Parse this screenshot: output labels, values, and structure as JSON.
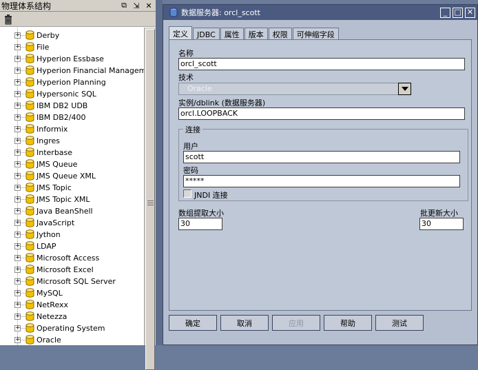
{
  "left_pane": {
    "title": "物理体系结构",
    "header_buttons": [
      "⧉",
      "⇲",
      "✕"
    ],
    "tree_items": [
      "Derby",
      "File",
      "Hyperion Essbase",
      "Hyperion Financial Management",
      "Hyperion Planning",
      "Hypersonic SQL",
      "IBM DB2 UDB",
      "IBM DB2/400",
      "Informix",
      "Ingres",
      "Interbase",
      "JMS Queue",
      "JMS Queue XML",
      "JMS Topic",
      "JMS Topic XML",
      "Java BeanShell",
      "JavaScript",
      "Jython",
      "LDAP",
      "Microsoft Access",
      "Microsoft Excel",
      "Microsoft SQL Server",
      "MySQL",
      "NetRexx",
      "Netezza",
      "Operating System",
      "Oracle"
    ],
    "expander_symbol": "+",
    "icons": {
      "toolbar": "trash-icon",
      "tree_item": "database-icon"
    }
  },
  "dialog": {
    "title": "数据服务器: orcl_scott",
    "window_buttons": [
      "_",
      "□",
      "✕"
    ],
    "tabs": [
      "定义",
      "JDBC",
      "属性",
      "版本",
      "权限",
      "可伸缩字段"
    ],
    "active_tab": "定义",
    "form": {
      "name_label": "名称",
      "name_value": "orcl_scott",
      "tech_label": "技术",
      "tech_value": "Oracle",
      "instance_label": "实例/dblink (数据服务器)",
      "instance_value": "orcl.LOOPBACK",
      "connection_legend": "连接",
      "user_label": "用户",
      "user_value": "scott",
      "password_label": "密码",
      "password_value": "*****",
      "jndi_label": "JNDI 连接",
      "jndi_checked": false,
      "array_fetch_label": "数组提取大小",
      "array_fetch_value": "30",
      "batch_update_label": "批更新大小",
      "batch_update_value": "30"
    },
    "buttons": {
      "ok": "确定",
      "cancel": "取消",
      "apply": "应用",
      "help": "帮助",
      "test": "测试"
    }
  },
  "colors": {
    "titlebar": "#4a5a80",
    "dialog_bg": "#b5bfcf",
    "panel_bg": "#bfc8d7",
    "db_icon": "#f2c200"
  }
}
